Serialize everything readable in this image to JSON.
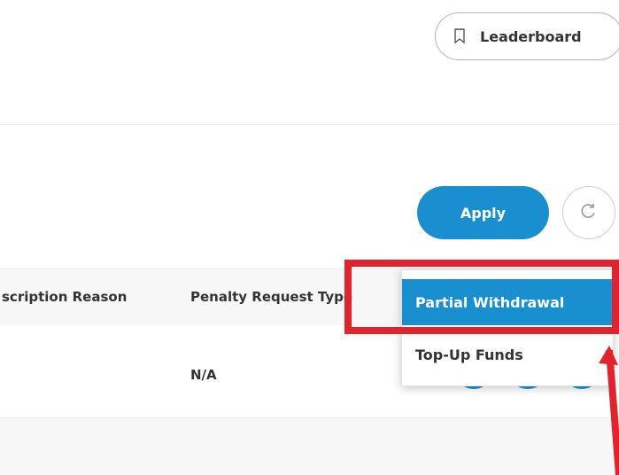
{
  "header": {
    "leaderboard_label": "Leaderboard",
    "leaderboard_icon": "bookmark-icon"
  },
  "filters": {
    "apply_label": "Apply",
    "refresh_icon": "refresh-icon",
    "accent_color": "#1a8fd0"
  },
  "table": {
    "columns": [
      "scription Reason",
      "Penalty Request Type"
    ],
    "rows": [
      {
        "penalty_request_type": "N/A"
      }
    ]
  },
  "dropdown": {
    "options": [
      "Partial Withdrawal",
      "Top-Up Funds"
    ],
    "selected": "Partial Withdrawal"
  },
  "annotation": {
    "highlight_color": "#e0232d"
  }
}
